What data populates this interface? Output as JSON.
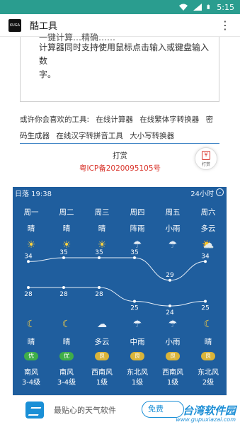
{
  "status_bar": {
    "time": "5:15",
    "icons": [
      "wifi-icon",
      "signal-icon",
      "battery-icon"
    ]
  },
  "app_bar": {
    "logo_text": "KUGA",
    "title": "酷工具",
    "menu_icon": "more-vertical-icon"
  },
  "description": {
    "cut_line": "一键计算…精确……",
    "lines": [
      "计算器同时支持使用鼠标点击输入或键盘输入数",
      "字。"
    ]
  },
  "tools": {
    "intro": "或许你会喜欢的工具:",
    "links": [
      "在线计算器",
      "在线繁体字转换器",
      "密码生成器",
      "在线汉字转拼音工具",
      "大小写转换器"
    ]
  },
  "reward": {
    "label": "打赏",
    "icp": "粤ICP备2020095105号",
    "button_label": "打赏"
  },
  "weather": {
    "location_time": "日落 19:38",
    "mode": "24小时",
    "days": [
      {
        "day": "周一",
        "day_cond": "晴",
        "day_icon": "sun-icon",
        "high": "34",
        "low": "28",
        "night_icon": "moon-icon",
        "night_cond": "晴",
        "aqi": "优",
        "wind": "南风",
        "level": "3-4级"
      },
      {
        "day": "周二",
        "day_cond": "晴",
        "day_icon": "sun-icon",
        "high": "35",
        "low": "28",
        "night_icon": "moon-icon",
        "night_cond": "晴",
        "aqi": "优",
        "wind": "南风",
        "level": "3-4级"
      },
      {
        "day": "周三",
        "day_cond": "晴",
        "day_icon": "sun-icon",
        "high": "35",
        "low": "28",
        "night_icon": "moon-cloud-icon",
        "night_cond": "多云",
        "aqi": "良",
        "wind": "西南风",
        "level": "1级"
      },
      {
        "day": "周四",
        "day_cond": "阵雨",
        "day_icon": "shower-icon",
        "high": "35",
        "low": "25",
        "night_icon": "rain-icon",
        "night_cond": "中雨",
        "aqi": "良",
        "wind": "东北风",
        "level": "1级"
      },
      {
        "day": "周五",
        "day_cond": "小雨",
        "day_icon": "rain-icon",
        "high": "29",
        "low": "24",
        "night_icon": "rain-icon",
        "night_cond": "小雨",
        "aqi": "良",
        "wind": "西南风",
        "level": "1级"
      },
      {
        "day": "周六",
        "day_cond": "多云",
        "day_icon": "partly-cloudy-icon",
        "high": "34",
        "low": "25",
        "night_icon": "moon-icon",
        "night_cond": "晴",
        "aqi": "良",
        "wind": "东北风",
        "level": "2级"
      }
    ],
    "aqi_colors": {
      "优": "#3fae49",
      "良": "#d9b43a"
    }
  },
  "ad": {
    "text": "最贴心的天气软件",
    "button": "免费"
  },
  "watermark": {
    "main": "台湾软件园",
    "sub": "www.gupuxiazai.com"
  }
}
